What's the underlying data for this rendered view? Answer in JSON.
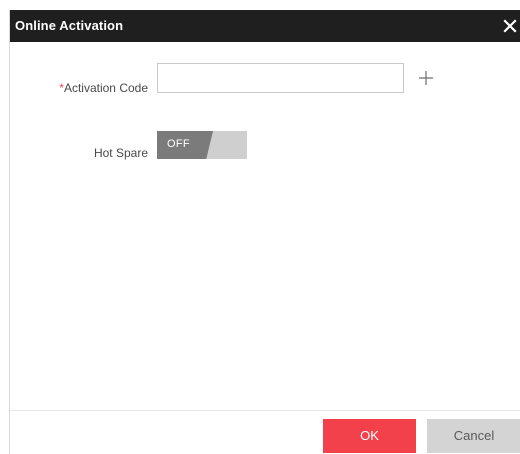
{
  "dialog": {
    "title": "Online Activation",
    "close_icon": "close-icon"
  },
  "form": {
    "activation_code": {
      "required_mark": "*",
      "label": "Activation Code",
      "value": "",
      "placeholder": "",
      "add_icon": "plus-icon"
    },
    "hot_spare": {
      "label": "Hot Spare",
      "state_text": "OFF",
      "enabled": false
    }
  },
  "footer": {
    "ok_label": "OK",
    "cancel_label": "Cancel"
  },
  "colors": {
    "titlebar": "#1f1f1f",
    "accent": "#f3414b",
    "toggle_off": "#7b7b7b",
    "toggle_track": "#cfcfcf",
    "cancel": "#d4d4d4"
  }
}
